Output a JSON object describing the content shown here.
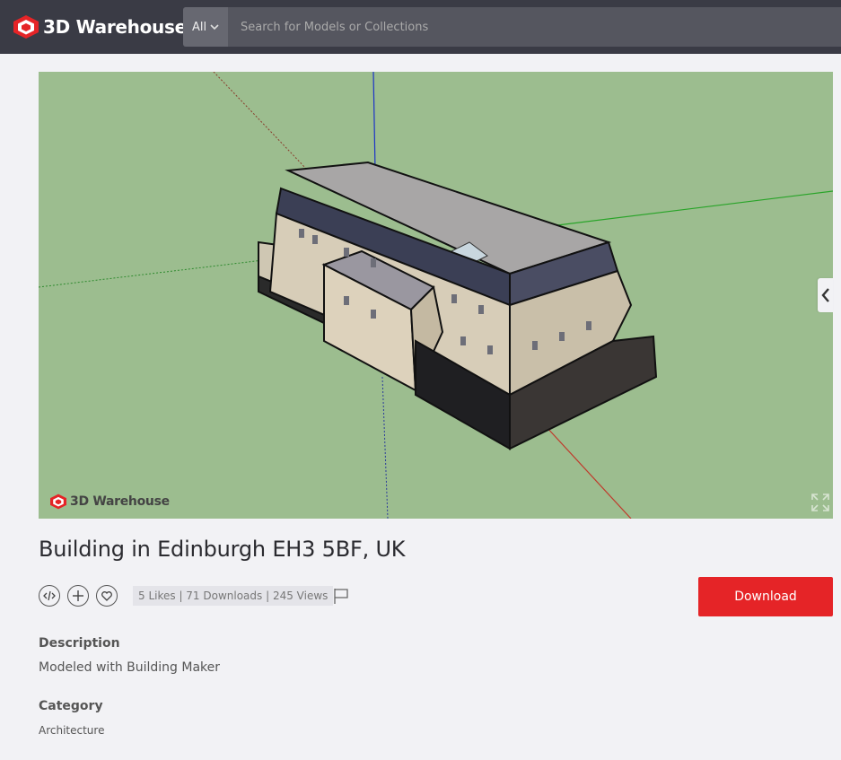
{
  "header": {
    "logo_text": "3D Warehouse",
    "search_filter_label": "All",
    "search_placeholder": "Search for Models or Collections"
  },
  "viewer": {
    "watermark_text": "3D Warehouse",
    "background_color": "#9cbd8f",
    "axes": {
      "x_color": "#c0392b",
      "y_color": "#28a428",
      "z_color": "#1c33c7"
    }
  },
  "model": {
    "title": "Building in Edinburgh EH3 5BF, UK",
    "stats": "5 Likes | 71 Downloads | 245 Views",
    "download_label": "Download",
    "description_label": "Description",
    "description": "Modeled with Building Maker",
    "category_label": "Category",
    "category": "Architecture"
  },
  "icons": [
    "logo-icon",
    "chevron-down-icon",
    "expand-icon",
    "chevron-left-icon",
    "embed-code-icon",
    "plus-icon",
    "heart-icon",
    "flag-icon"
  ],
  "colors": {
    "header_bg": "#3a3b45",
    "accent": "#e52427",
    "page_bg": "#f2f2f5"
  }
}
